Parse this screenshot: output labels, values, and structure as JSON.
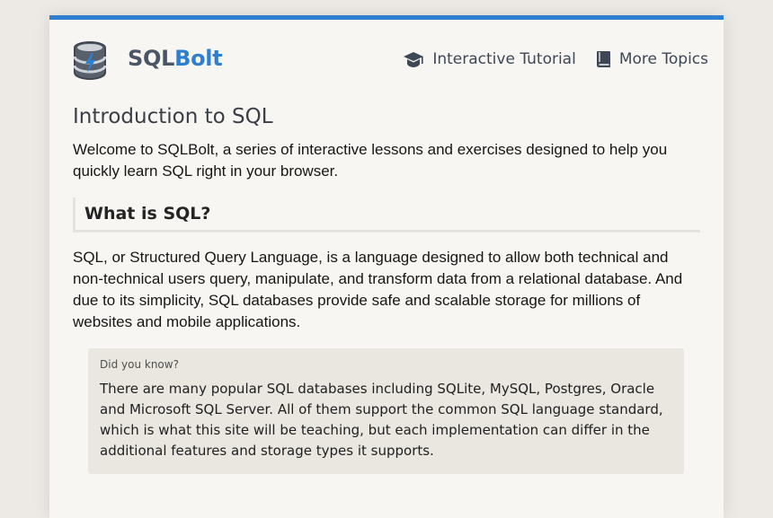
{
  "header": {
    "brand_primary": "SQL",
    "brand_accent": "Bolt",
    "logo_icon": "database-bolt-icon",
    "nav": [
      {
        "label": "Interactive Tutorial",
        "icon": "graduation-cap-icon"
      },
      {
        "label": "More Topics",
        "icon": "book-icon"
      }
    ]
  },
  "colors": {
    "accent": "#2f7fd0",
    "page_bg": "#ede9e5",
    "card_bg": "#f7f6f2",
    "callout_bg": "#e9e7df"
  },
  "main": {
    "title": "Introduction to SQL",
    "intro": "Welcome to SQLBolt, a series of interactive lessons and exercises designed to help you quickly learn SQL right in your browser.",
    "section_title": "What is SQL?",
    "section_body": "SQL, or Structured Query Language, is a language designed to allow both technical and non-technical users query, manipulate, and transform data from a relational database. And due to its simplicity, SQL databases provide safe and scalable storage for millions of websites and mobile applications.",
    "callout": {
      "label": "Did you know?",
      "text": "There are many popular SQL databases including SQLite, MySQL, Postgres, Oracle and Microsoft SQL Server. All of them support the common SQL language standard, which is what this site will be teaching, but each implementation can differ in the additional features and storage types it supports."
    }
  }
}
